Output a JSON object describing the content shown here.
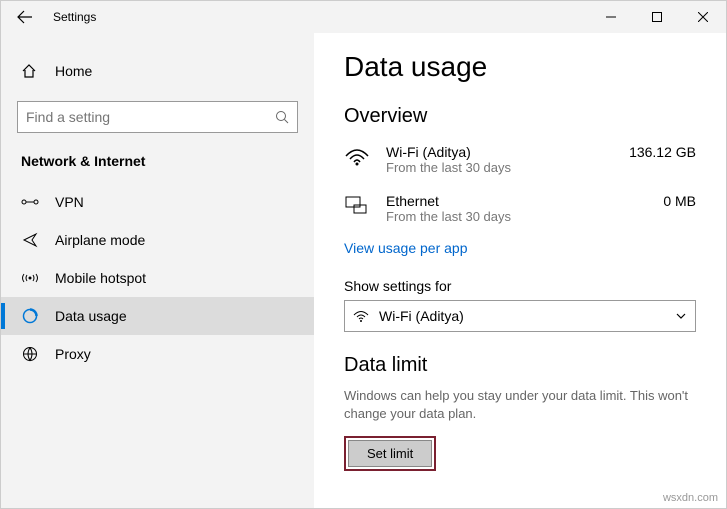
{
  "titlebar": {
    "title": "Settings"
  },
  "sidebar": {
    "home": "Home",
    "search_placeholder": "Find a setting",
    "section": "Network & Internet",
    "items": [
      {
        "label": "VPN"
      },
      {
        "label": "Airplane mode"
      },
      {
        "label": "Mobile hotspot"
      },
      {
        "label": "Data usage"
      },
      {
        "label": "Proxy"
      }
    ]
  },
  "content": {
    "heading": "Data usage",
    "overview": {
      "title": "Overview",
      "networks": [
        {
          "name": "Wi-Fi (Aditya)",
          "sub": "From the last 30 days",
          "value": "136.12 GB"
        },
        {
          "name": "Ethernet",
          "sub": "From the last 30 days",
          "value": "0 MB"
        }
      ],
      "link": "View usage per app"
    },
    "show_settings_label": "Show settings for",
    "show_settings_value": "Wi-Fi (Aditya)",
    "data_limit": {
      "title": "Data limit",
      "desc": "Windows can help you stay under your data limit. This won't change your data plan.",
      "button": "Set limit"
    }
  },
  "watermark": "wsxdn.com"
}
